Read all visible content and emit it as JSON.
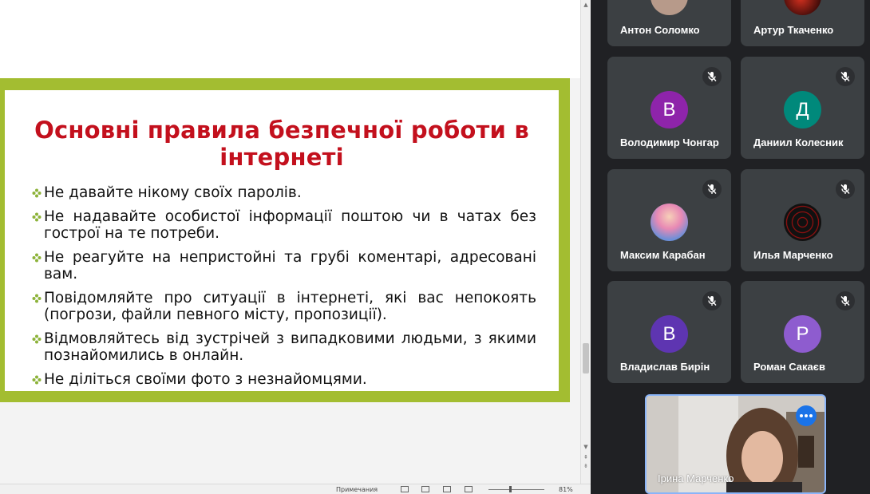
{
  "slide": {
    "title": "Основні правила безпечної роботи в інтернеті",
    "bullets": [
      "Не давайте нікому своїх паролів.",
      "Не надавайте особистої інформації поштою чи в чатах без гострої на те потреби.",
      "Не реагуйте на непристойні та грубі коментарі, адресовані вам.",
      "Повідомляйте про ситуації в інтернеті, які вас непокоять (погрози, файли певного місту, пропозиції).",
      "Відмовляйтесь від зустрічей з випадковими людьми, з якими познайомились в онлайн.",
      "Не діліться своїми фото з незнайомцями."
    ]
  },
  "statusbar": {
    "notes_label": "Примечания",
    "zoom": "81%"
  },
  "participants": [
    {
      "name": "Антон Соломко",
      "avatar": "photo"
    },
    {
      "name": "Артур Ткаченко",
      "avatar": "photo"
    },
    {
      "name": "Володимир Чонгар",
      "initial": "В",
      "color": "#8e24aa",
      "muted": true
    },
    {
      "name": "Даниил Колесник",
      "initial": "Д",
      "color": "#00897b",
      "muted": true
    },
    {
      "name": "Максим Карабан",
      "avatar": "anime-photo",
      "muted": true
    },
    {
      "name": "Илья Марченко",
      "avatar": "red-hex-photo",
      "muted": true
    },
    {
      "name": "Владислав Бирін",
      "initial": "В",
      "color": "#5e35b1",
      "muted": true
    },
    {
      "name": "Роман Сакаєв",
      "initial": "Р",
      "color": "#8e5ccf",
      "muted": true
    }
  ],
  "self": {
    "name": "Ірина Марченко"
  },
  "colors": {
    "slide_border": "#a3bd31",
    "title": "#c3101d",
    "tile_bg": "#3c4043",
    "self_border": "#8ab4f8",
    "more_button": "#1a73e8"
  }
}
